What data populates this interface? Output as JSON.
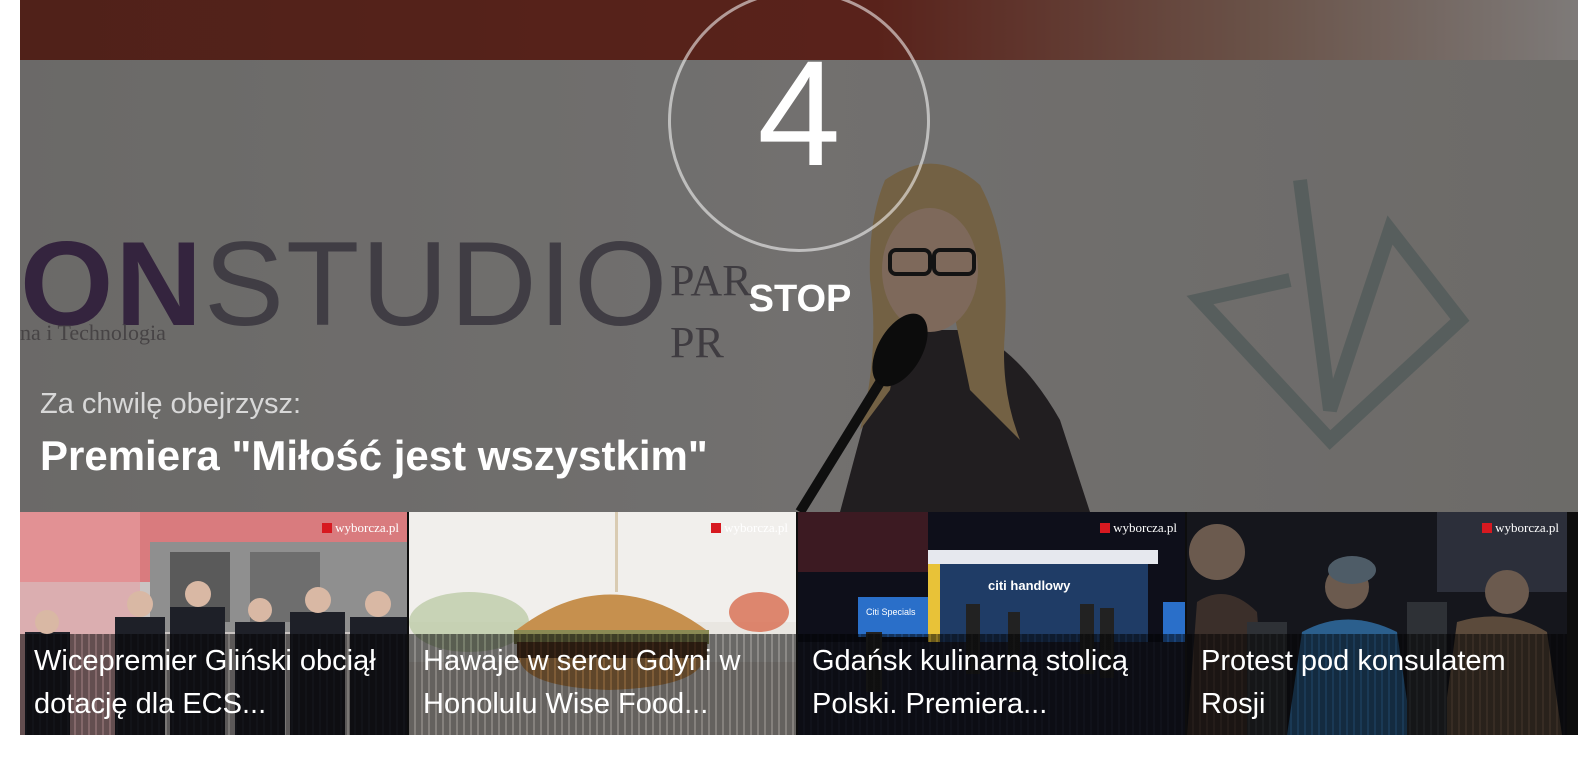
{
  "countdown": {
    "number": "4",
    "stop_label": "STOP"
  },
  "up_next": {
    "label": "Za chwilę obejrzysz:",
    "title": "Premiera \"Miłość jest wszystkim\""
  },
  "background": {
    "logo_bold": "ON",
    "logo_rest": "STUDIO",
    "logo_sub": "na i Technologia",
    "pa_line1": "PAR",
    "pa_line2": "PR"
  },
  "related": [
    {
      "title": "Wicepremier Gliński obciął dotację dla ECS...",
      "brand": "wyborcza.pl",
      "theme": "press"
    },
    {
      "title": "Hawaje w sercu Gdyni w Honolulu Wise Food...",
      "brand": "wyborcza.pl",
      "theme": "burger"
    },
    {
      "title": "Gdańsk kulinarną stolicą Polski. Premiera...",
      "brand": "wyborcza.pl",
      "theme": "stage",
      "stage_sign": "citi handlowy",
      "stage_screen": "Citi Specials"
    },
    {
      "title": "Protest pod konsulatem Rosji",
      "brand": "wyborcza.pl",
      "theme": "protest"
    }
  ],
  "colors": {
    "brand_red": "#d71920",
    "overlay_text": "#ffffff"
  }
}
